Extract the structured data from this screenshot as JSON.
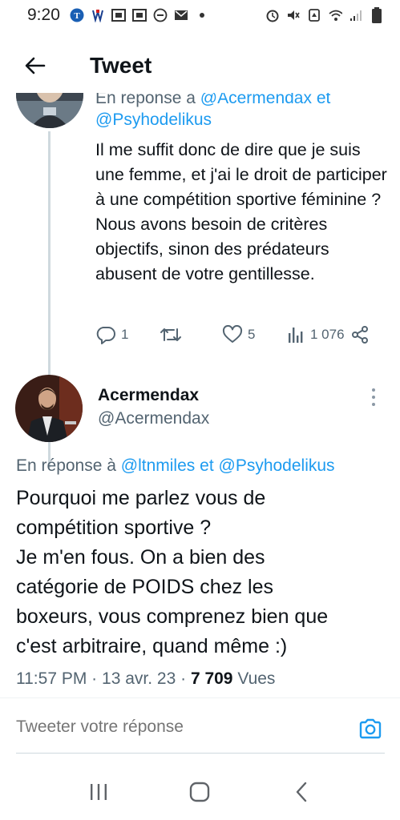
{
  "status_bar": {
    "time": "9:20",
    "icons_left": [
      "nyt-icon",
      "news-icon",
      "photo-icon",
      "gallery-icon",
      "dnd-icon",
      "mail-icon",
      "dot-icon"
    ],
    "icons_right": [
      "alarm-icon",
      "mute-icon",
      "recycle-icon",
      "wifi-icon",
      "signal-icon",
      "battery-icon"
    ]
  },
  "header": {
    "title": "Tweet"
  },
  "previous_tweet": {
    "reply_prefix": "En réponse à",
    "reply_mention_1": "@Acermendax et",
    "reply_mention_2": "@Psyhodelikus",
    "text": "Il me suffit donc de dire que je suis une femme, et j'ai le droit de participer à une compétition sportive féminine ? Nous avons besoin de critères objectifs, sinon des prédateurs abusent de votre gentillesse.",
    "replies": "1",
    "retweets": "",
    "likes": "5",
    "views": "1 076"
  },
  "main_tweet": {
    "author_name": "Acermendax",
    "author_handle": "@Acermendax",
    "reply_prefix": "En réponse à",
    "reply_mention_1": "@ltnmiles",
    "reply_conj": "et",
    "reply_mention_2": "@Psyhodelikus",
    "text_lines": [
      "Pourquoi me parlez vous de",
      "compétition sportive ?",
      "Je m'en fous. On a bien des",
      "catégorie de POIDS chez les",
      "boxeurs, vous comprenez bien que",
      "c'est arbitraire, quand même :)"
    ],
    "time": "11:57 PM",
    "date": "13 avr. 23",
    "views_count": "7 709",
    "views_label": "Vues"
  },
  "compose": {
    "placeholder": "Tweeter votre réponse"
  },
  "colors": {
    "accent": "#1d9bf0",
    "text": "#0f1419",
    "secondary": "#536471"
  }
}
